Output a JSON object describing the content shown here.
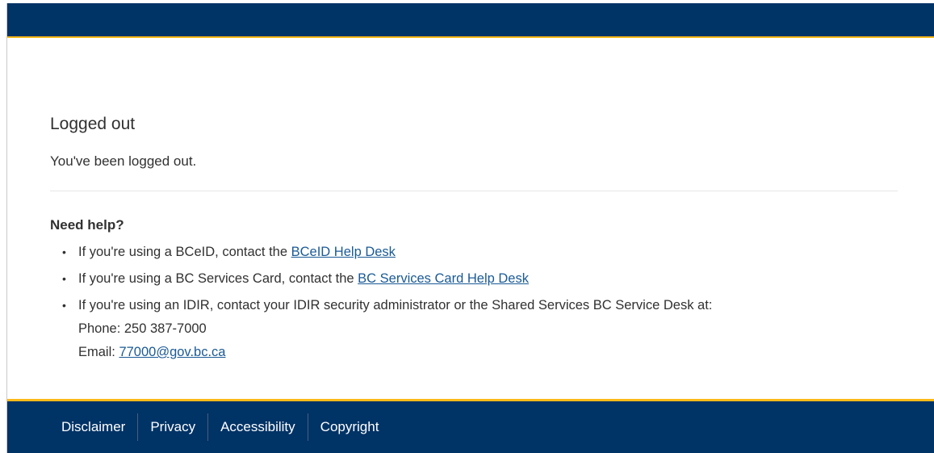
{
  "header": {
    "brand_color": "#003366",
    "accent_color": "#fcba19"
  },
  "main": {
    "title": "Logged out",
    "message": "You've been logged out.",
    "help": {
      "heading": "Need help?",
      "items": [
        {
          "text": "If you're using a BCeID, contact the ",
          "link": "BCeID Help Desk"
        },
        {
          "text": "If you're using a BC Services Card, contact the ",
          "link": "BC Services Card Help Desk"
        },
        {
          "text": "If you're using an IDIR, contact your IDIR security administrator or the Shared Services BC Service Desk at:",
          "phone_label": "Phone: 250 387-7000",
          "email_label": "Email: ",
          "email_link": "77000@gov.bc.ca"
        }
      ]
    }
  },
  "footer": {
    "links": [
      "Disclaimer",
      "Privacy",
      "Accessibility",
      "Copyright"
    ]
  }
}
